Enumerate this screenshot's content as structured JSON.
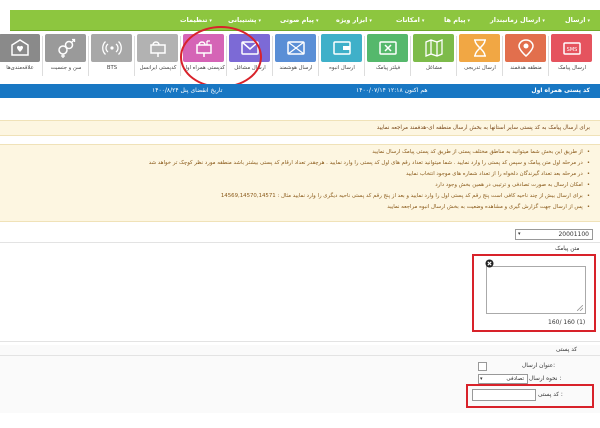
{
  "nav": {
    "items": [
      "ارسال",
      "ارسال زمانبندار",
      "پیام ها",
      "امکانات",
      "ابزار ویژه",
      "پیام صوتی",
      "پشتیبانی",
      "تنظیمات"
    ]
  },
  "tiles": [
    {
      "label": "ارسال پیامک",
      "icon": "sms-card-icon",
      "color": "#e5535e"
    },
    {
      "label": "منطقه هدفمند",
      "icon": "location-pin-icon",
      "color": "#e26f4d"
    },
    {
      "label": "ارسال تدریجی",
      "icon": "hourglass-icon",
      "color": "#f1a744"
    },
    {
      "label": "مشاغل",
      "icon": "map-icon",
      "color": "#7dbb4a"
    },
    {
      "label": "فیلتر پیامک",
      "icon": "filter-envelope-icon",
      "color": "#55b86c"
    },
    {
      "label": "ارسال انبوه",
      "icon": "wallet-icon",
      "color": "#3fb0c9"
    },
    {
      "label": "ارسال هوشمند",
      "icon": "envelope-cross-icon",
      "color": "#5a8fd6"
    },
    {
      "label": "ارسال مشاغل",
      "icon": "envelope-icon",
      "color": "#7c6ad6"
    },
    {
      "label": "کدپستی همراه اول",
      "icon": "mailbox-icon",
      "color": "#d564b6"
    },
    {
      "label": "کدپستی ایرانسل",
      "icon": "mailbox-gray-icon",
      "color": "#b2b2b2"
    },
    {
      "label": "BTS",
      "icon": "signal-icon",
      "color": "#a8a8a8"
    },
    {
      "label": "سن و جنسیت",
      "icon": "gender-icon",
      "color": "#9a9a9a"
    },
    {
      "label": "علاقه‌مندی‌ها",
      "icon": "heart-envelope-icon",
      "color": "#8a8a8a"
    }
  ],
  "bluebar": {
    "title": "کد پستی همراه اول",
    "now": "هم اکنون ۱۲:۱۸ ۱۴۰۰/۰۷/۱۴",
    "expiry": "تاریخ انقضای پنل ۱۴۰۰/۸/۲۴"
  },
  "notice1": "برای ارسال پیامک به کد پستی سایر استانها به بخش ارسال منطقه ای-هدفمند مراجعه نمایید",
  "bullets": [
    "از طریق این بخش شما میتوانید به مناطق مختلف پستی از طریق کد پستی پیامک ارسال نمایید",
    "در مرحله اول متن پیامک و سپس کد پستی را وارد نمایید . شما میتوانید تعداد رقم های اول کد پستی را وارد نمایید . هرچقدر تعداد ارقام کد پستی بیشتر باشد منطقه مورد نظر کوچک تر خواهد شد",
    "در مرحله بعد تعداد گیرندگان دلخواه را از تعداد شماره های موجود انتخاب نمایید",
    "امکان ارسال به صورت تصادفی و ترتیبی در همین بخش وجود دارد",
    "برای ارسال بیش از چند ناحیه کافی است پنج رقم کد پستی اول را وارد نمایید و بعد از پنج رقم کد پستی ناحیه دیگری را وارد نمایید مثال : 14569,14570,14571",
    "پس از ارسال جهت گزارش گیری و مشاهده وضعیت به بخش ارسال انبوه مراجعه نمایید"
  ],
  "form": {
    "sender": "20001100",
    "message_label": "متن پیامک",
    "counter": "160/ 160  (1)",
    "postal_section": "کد پستی",
    "send_title_label": "عنوان ارسال:",
    "send_mode_label": "نحوه ارسال :",
    "send_mode_value": "تصادفی",
    "postal_code_label": "کد پستی :"
  }
}
